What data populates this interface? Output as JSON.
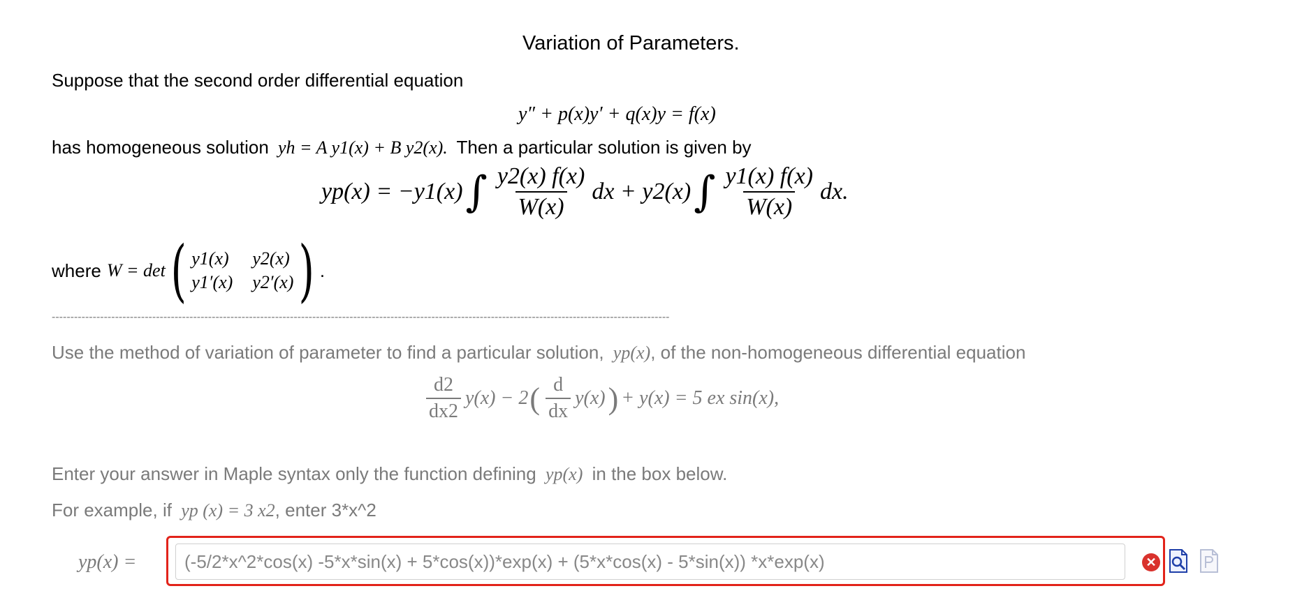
{
  "header": {
    "title": "Variation of Parameters."
  },
  "intro": {
    "line1": "Suppose that the second order differential equation",
    "equation1": "y″ + p(x)y′ + q(x)y = f(x)",
    "line2_prefix": "has homogeneous solution",
    "line2_math": "yh = A y1(x) + B y2(x).",
    "line2_suffix": "Then a particular solution is given by",
    "particular": {
      "lhs": "yp(x) = −y1(x)",
      "frac1_num": "y2(x) f(x)",
      "frac1_den": "W(x)",
      "mid": "dx  +  y2(x)",
      "frac2_num": "y1(x) f(x)",
      "frac2_den": "W(x)",
      "end": "dx."
    },
    "wronskian_prefix": "where",
    "wronskian_eq": "W = det",
    "matrix": {
      "a": "y1(x)",
      "b": "y2(x)",
      "c": "y1′(x)",
      "d": "y2′(x)"
    },
    "wronskian_end": "."
  },
  "separator": "----------------------------------------------------------------------------------------------------------------------------------------------------------------------",
  "problem": {
    "prompt_prefix": "Use the method of variation of parameter to find a particular solution,",
    "prompt_math": "yp(x)",
    "prompt_suffix": ", of the non-homogeneous differential equation",
    "ode": {
      "d2num": "d2",
      "d2den": "dx2",
      "term1": "y(x) − 2",
      "dnum": "d",
      "dden": "dx",
      "term2": "y(x)",
      "rhs": "+ y(x) = 5 ex sin(x),"
    }
  },
  "instructions": {
    "line1_prefix": "Enter your answer in Maple syntax only the function defining",
    "line1_math": "yp(x)",
    "line1_suffix": "in the box below.",
    "line2_prefix": "For example, if",
    "line2_math": "yp (x) = 3 x2",
    "line2_suffix": ", enter 3*x^2"
  },
  "answer": {
    "label": "yp(x) =",
    "value": "(-5/2*x^2*cos(x) -5*x*sin(x) + 5*cos(x))*exp(x) + (5*x*cos(x) - 5*sin(x)) *x*exp(x)",
    "status_icon": "error-x-icon",
    "colors": {
      "error_border": "#e2231a",
      "error_icon": "#d9322d",
      "preview_icon": "#1f3fa8"
    }
  },
  "tools": [
    {
      "name": "preview-icon"
    },
    {
      "name": "maple-syntax-icon"
    }
  ]
}
